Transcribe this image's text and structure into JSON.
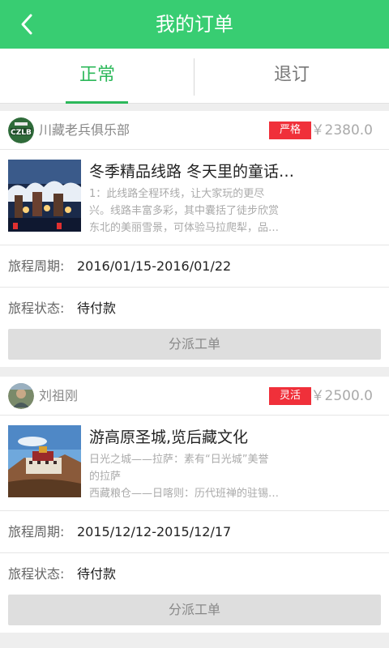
{
  "header": {
    "title": "我的订单",
    "back_icon": "chevron-left-icon"
  },
  "tabs": [
    {
      "label": "正常",
      "active": true
    },
    {
      "label": "退订",
      "active": false
    }
  ],
  "colors": {
    "accent": "#38cd72",
    "tab_active": "#2cb85a",
    "badge": "#f0303a"
  },
  "orders": [
    {
      "club": "川藏老兵俱乐部",
      "badge": "严格",
      "price": "￥2380.0",
      "title": "冬季精品线路 冬天里的童话…",
      "desc": [
        "1：此线路全程环线，让大家玩的更尽",
        "兴。线路丰富多彩，其中囊括了徒步欣赏",
        "东北的美丽雪景，可体验马拉爬犁，品…"
      ],
      "period_label": "旅程周期:",
      "period": "2016/01/15-2016/01/22",
      "status_label": "旅程状态:",
      "status": "待付款",
      "button": "分派工单"
    },
    {
      "club": "刘祖刚",
      "badge": "灵活",
      "price": "￥2500.0",
      "title": "游高原圣城,览后藏文化",
      "desc": [
        "日光之城——拉萨：素有“日光城”美誉",
        "的拉萨",
        "西藏粮仓——日喀则：历代班禅的驻锡…"
      ],
      "period_label": "旅程周期:",
      "period": "2015/12/12-2015/12/17",
      "status_label": "旅程状态:",
      "status": "待付款",
      "button": "分派工单"
    }
  ]
}
